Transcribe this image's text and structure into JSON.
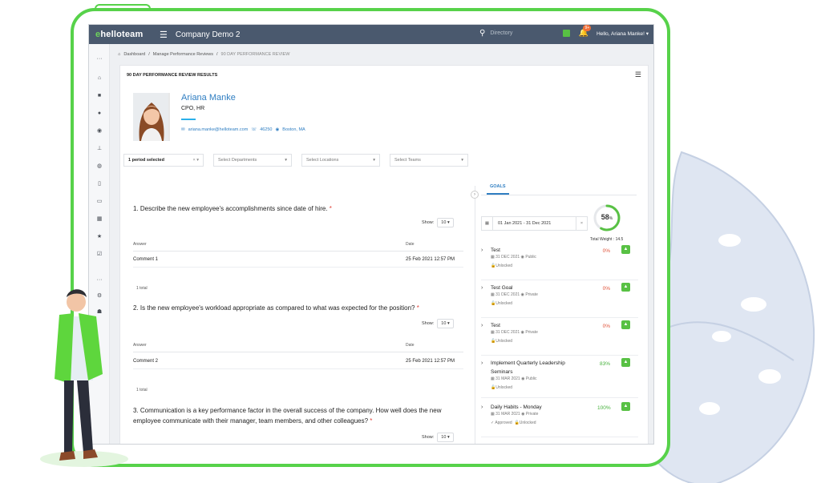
{
  "topbar": {
    "logo": "helloteam",
    "company": "Company Demo 2",
    "search_placeholder": "Directory",
    "notification_count": "9+",
    "user_greeting": "Hello, Ariana Manke!"
  },
  "breadcrumb": [
    "Dashboard",
    "Manage Performance Reviews",
    "90 DAY PERFORMANCE REVIEW"
  ],
  "card": {
    "title": "90 DAY PERFORMANCE REVIEW RESULTS"
  },
  "profile": {
    "name": "Ariana Manke",
    "role": "CPO, HR",
    "email": "ariana.manke@helloteam.com",
    "phone": "46250",
    "location": "Boston, MA"
  },
  "filters": {
    "period": "1 period selected",
    "departments": "Select Departments",
    "locations": "Select Locations",
    "teams": "Select Teams"
  },
  "table_headers": {
    "answer": "Answer",
    "date": "Date"
  },
  "show_label": "Show:",
  "questions": [
    {
      "text": "1. Describe the new employee's accomplishments since date of hire.",
      "show": "10",
      "answer": "Comment 1",
      "date": "25 Feb 2021 12:57 PM",
      "total": "1 total"
    },
    {
      "text": "2. Is the new employee's workload appropriate as compared to what was expected for the position?",
      "show": "10",
      "answer": "Comment 2",
      "date": "25 Feb 2021 12:57 PM",
      "total": "1 total"
    },
    {
      "text": "3. Communication is a key performance factor in the overall success of the company. How well does the new employee communicate with their manager, team members, and other colleagues?",
      "show": "10"
    }
  ],
  "goals": {
    "tab": "GOALS",
    "date_range": "01 Jan 2021 - 31 Dec 2021",
    "progress": 58,
    "progress_unit": "%",
    "total_weight": "Total Weight : 14.5",
    "items": [
      {
        "name": "Test",
        "date": "31 DEC 2021",
        "visibility": "Public",
        "pct": "0%",
        "status": "Unlocked",
        "approved": ""
      },
      {
        "name": "Test Goal",
        "date": "31 DEC 2021",
        "visibility": "Private",
        "pct": "0%",
        "status": "Unlocked",
        "approved": ""
      },
      {
        "name": "Test",
        "date": "31 DEC 2021",
        "visibility": "Private",
        "pct": "0%",
        "status": "Unlocked",
        "approved": ""
      },
      {
        "name": "Implement Quarterly Leadership Seminars",
        "date": "31 MAR 2021",
        "visibility": "Public",
        "pct": "83%",
        "status": "Unlocked",
        "approved": ""
      },
      {
        "name": "Daily Habits - Monday",
        "date": "31 MAR 2021",
        "visibility": "Private",
        "pct": "100%",
        "status": "Unlocked",
        "approved": "Approved"
      }
    ]
  },
  "colors": {
    "accent_green": "#57d24a",
    "topbar": "#4a596e",
    "link_blue": "#2f7ec2"
  }
}
